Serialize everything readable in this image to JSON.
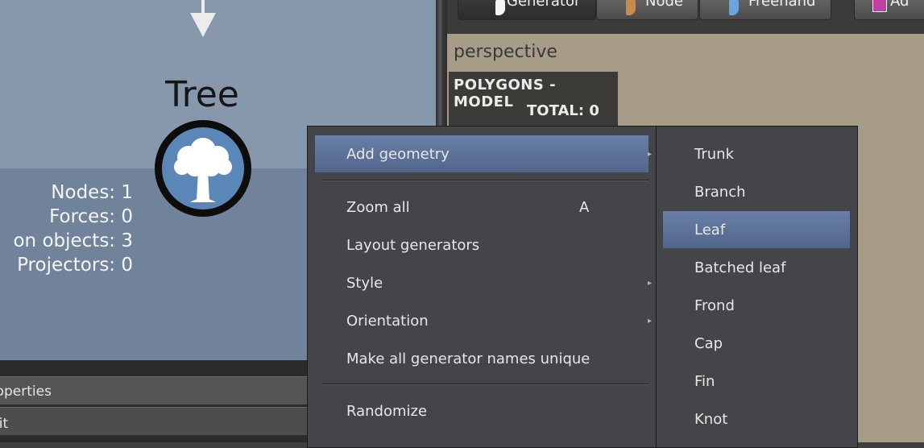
{
  "graph": {
    "node_title": "Tree",
    "stats": [
      {
        "text": "Nodes: 1"
      },
      {
        "text": "Forces: 0"
      },
      {
        "text": "on objects: 3"
      },
      {
        "text": "Projectors: 0"
      }
    ]
  },
  "panels": {
    "properties_label": "roperties",
    "edit_label": "dit"
  },
  "toolbar": {
    "buttons": [
      {
        "label": "Generator",
        "icon": "generator-brush-icon"
      },
      {
        "label": "Node",
        "icon": "node-brush-icon"
      },
      {
        "label": "Freehand",
        "icon": "freehand-brush-icon"
      },
      {
        "label": "Ad",
        "icon": "add-icon"
      }
    ]
  },
  "viewport": {
    "label": "perspective",
    "stats_title": "POLYGONS - MODEL",
    "stats_total": "TOTAL: 0"
  },
  "menu": {
    "items": [
      {
        "label": "Add geometry",
        "shortcut": "",
        "has_submenu": true
      },
      {
        "label": "Zoom all",
        "shortcut": "A",
        "has_submenu": false
      },
      {
        "label": "Layout generators",
        "shortcut": "",
        "has_submenu": false
      },
      {
        "label": "Style",
        "shortcut": "",
        "has_submenu": true
      },
      {
        "label": "Orientation",
        "shortcut": "",
        "has_submenu": true
      },
      {
        "label": "Make all generator names unique",
        "shortcut": "",
        "has_submenu": false
      },
      {
        "label": "Randomize",
        "shortcut": "",
        "has_submenu": false
      }
    ],
    "submenu_arrow": "▸"
  },
  "submenu": {
    "items": [
      {
        "label": "Trunk"
      },
      {
        "label": "Branch"
      },
      {
        "label": "Leaf"
      },
      {
        "label": "Batched leaf"
      },
      {
        "label": "Frond"
      },
      {
        "label": "Cap"
      },
      {
        "label": "Fin"
      },
      {
        "label": "Knot"
      }
    ]
  },
  "colors": {
    "accent": "#5b6f96",
    "canvas_bg": "#8798ad",
    "viewport_bg": "#a69c87",
    "tree_node_fill": "#5a86b8"
  }
}
